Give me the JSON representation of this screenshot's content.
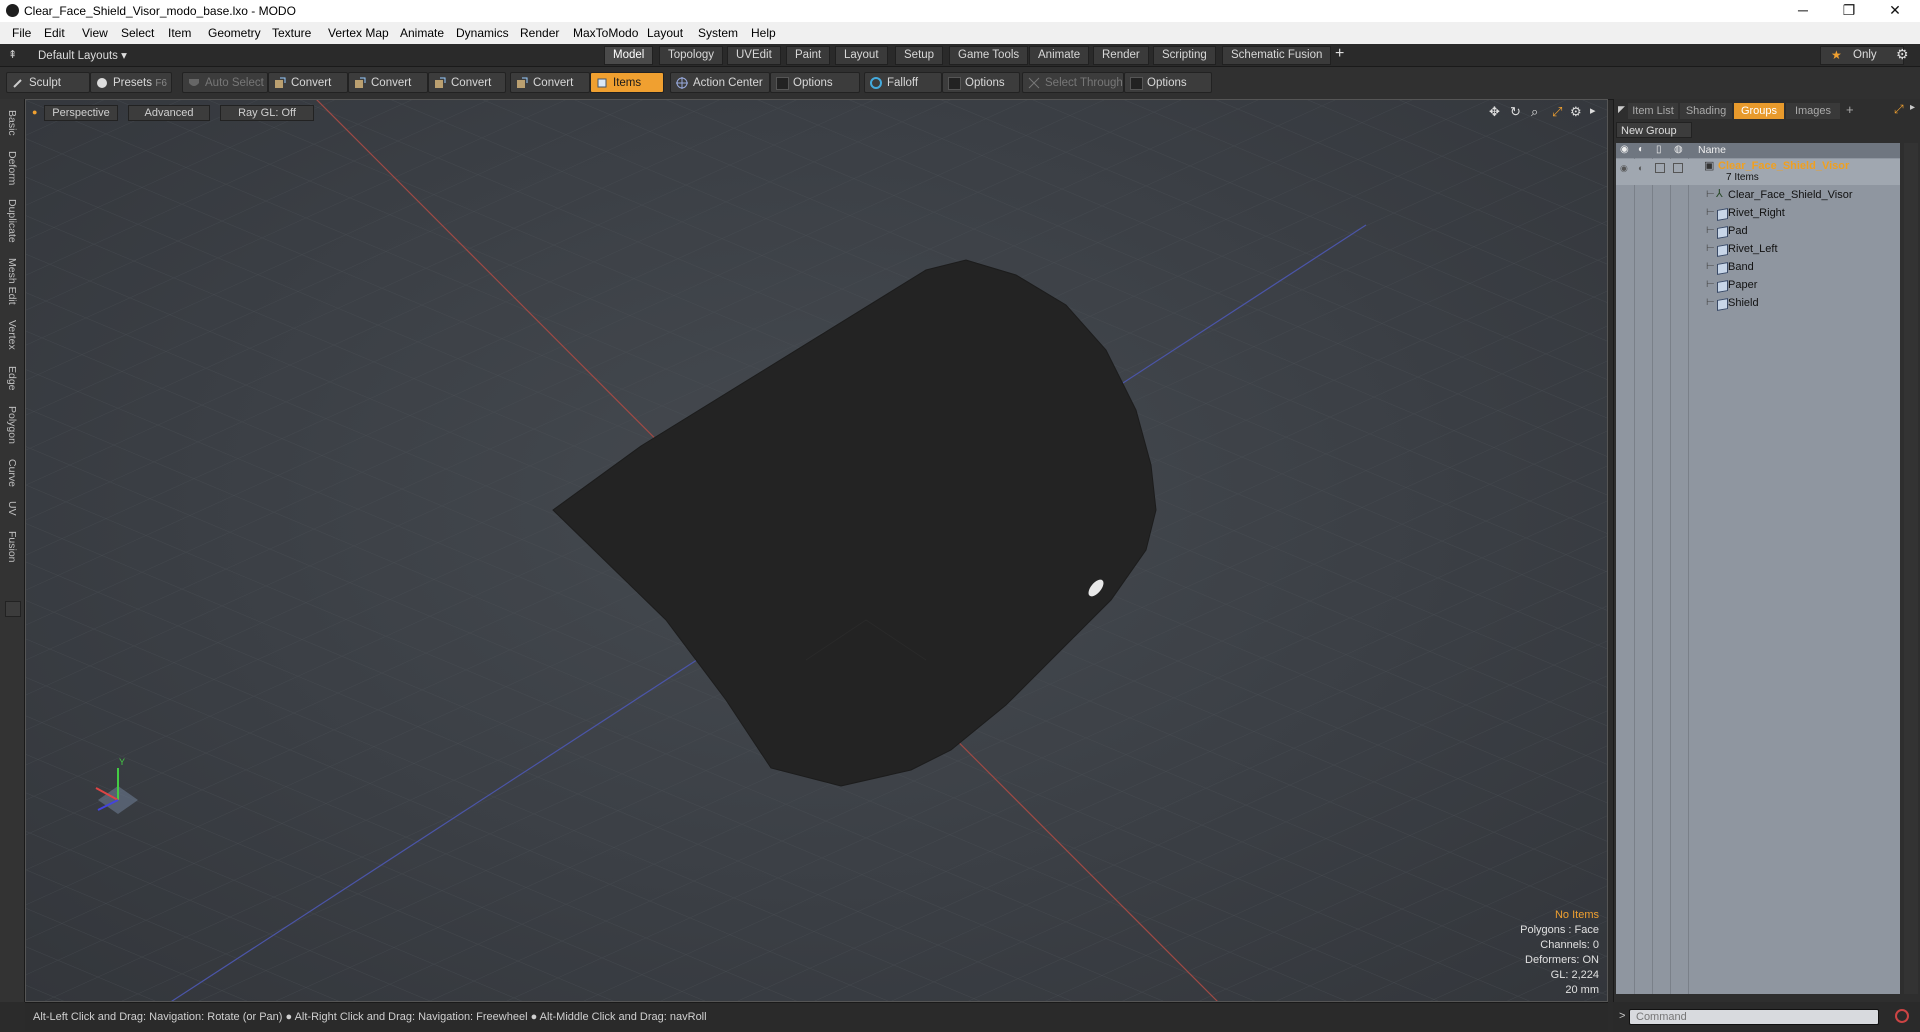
{
  "window": {
    "title": "Clear_Face_Shield_Visor_modo_base.lxo - MODO",
    "minimize": "─",
    "restore": "❐",
    "close": "✕"
  },
  "menu": [
    "File",
    "Edit",
    "View",
    "Select",
    "Item",
    "Geometry",
    "Texture",
    "Vertex Map",
    "Animate",
    "Dynamics",
    "Render",
    "MaxToModo",
    "Layout",
    "System",
    "Help"
  ],
  "layouts": {
    "label": "Default Layouts ▾",
    "tabs": [
      "Model",
      "Topology",
      "UVEdit",
      "Paint",
      "Layout",
      "Setup",
      "Game Tools",
      "Animate",
      "Render",
      "Scripting",
      "Schematic Fusion"
    ],
    "active_tab": "Model",
    "add": "+",
    "only": "Only"
  },
  "toolbar": {
    "sculpt": "Sculpt",
    "presets": "Presets",
    "presets_key": "F6",
    "auto_select": "Auto Select",
    "convert": "Convert",
    "items": "Items",
    "action_center": "Action Center",
    "options": "Options",
    "falloff": "Falloff",
    "select_through": "Select Through"
  },
  "left_tabs": [
    "Basic",
    "Deform",
    "Duplicate",
    "Mesh Edit",
    "Vertex",
    "Edge",
    "Polygon",
    "Curve",
    "UV",
    "Fusion"
  ],
  "viewport": {
    "view": "Perspective",
    "shading": "Advanced",
    "raygl": "Ray GL: Off",
    "hud": {
      "no_items": "No Items",
      "polygons": "Polygons : Face",
      "channels": "Channels: 0",
      "deformers": "Deformers: ON",
      "gl": "GL: 2,224",
      "scale": "20 mm"
    },
    "axis_y": "Y"
  },
  "right_panel": {
    "tabs": [
      "Item List",
      "Shading",
      "Groups",
      "Images"
    ],
    "active_tab": "Groups",
    "add": "+",
    "new_group": "New Group",
    "name_header": "Name",
    "group_name": "Clear_Face_Shield_Visor",
    "group_count": "7 Items",
    "items": [
      "Clear_Face_Shield_Visor",
      "Rivet_Right",
      "Pad",
      "Rivet_Left",
      "Band",
      "Paper",
      "Shield"
    ]
  },
  "status": {
    "text": "Alt-Left Click and Drag: Navigation: Rotate (or Pan) ● Alt-Right Click and Drag: Navigation: Freewheel ● Alt-Middle Click and Drag: navRoll"
  },
  "command": {
    "prompt": ">",
    "placeholder": "Command"
  },
  "colors": {
    "accent": "#f0a030",
    "group_name": "#f0a020",
    "list_bg": "#8f96a0"
  }
}
